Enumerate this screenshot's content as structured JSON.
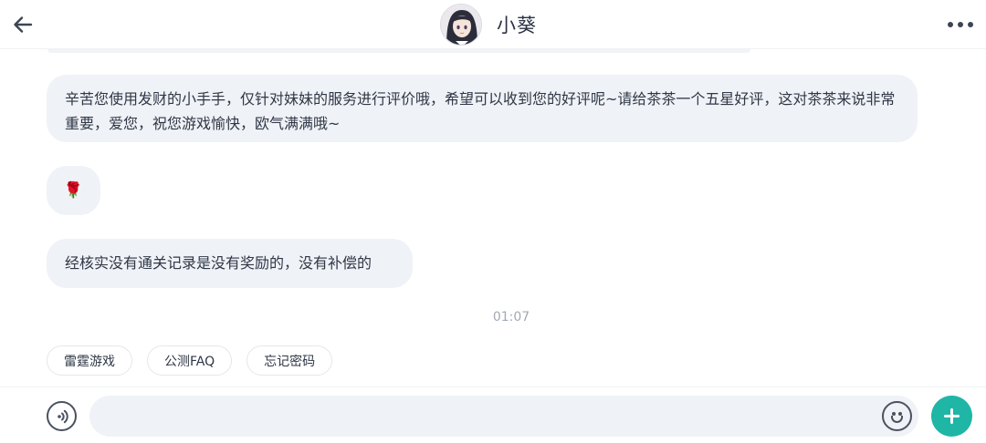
{
  "header": {
    "title": "小葵",
    "back_icon": "arrow-left-icon",
    "more_icon": "more-horizontal-icon",
    "avatar": "anime-girl-avatar"
  },
  "messages": [
    {
      "text": "辛苦您使用发财的小手手，仅针对妹妹的服务进行评价哦，希望可以收到您的好评呢~请给茶茶一个五星好评，这对茶茶来说非常重要，爱您，祝您游戏愉快，欧气满满哦~"
    },
    {
      "text": "🌹"
    },
    {
      "text": "经核实没有通关记录是没有奖励的，没有补偿的"
    }
  ],
  "timestamp": "01:07",
  "quick_replies": [
    "雷霆游戏",
    "公测FAQ",
    "忘记密码"
  ],
  "input": {
    "value": "",
    "placeholder": "",
    "voice_icon": "voice-icon",
    "emoji_icon": "smiley-icon",
    "add_icon": "plus-icon"
  },
  "colors": {
    "accent": "#1fb6a6",
    "bubble_bg": "#eff2f6",
    "text": "#2f3746",
    "muted": "#a3a9b3"
  }
}
